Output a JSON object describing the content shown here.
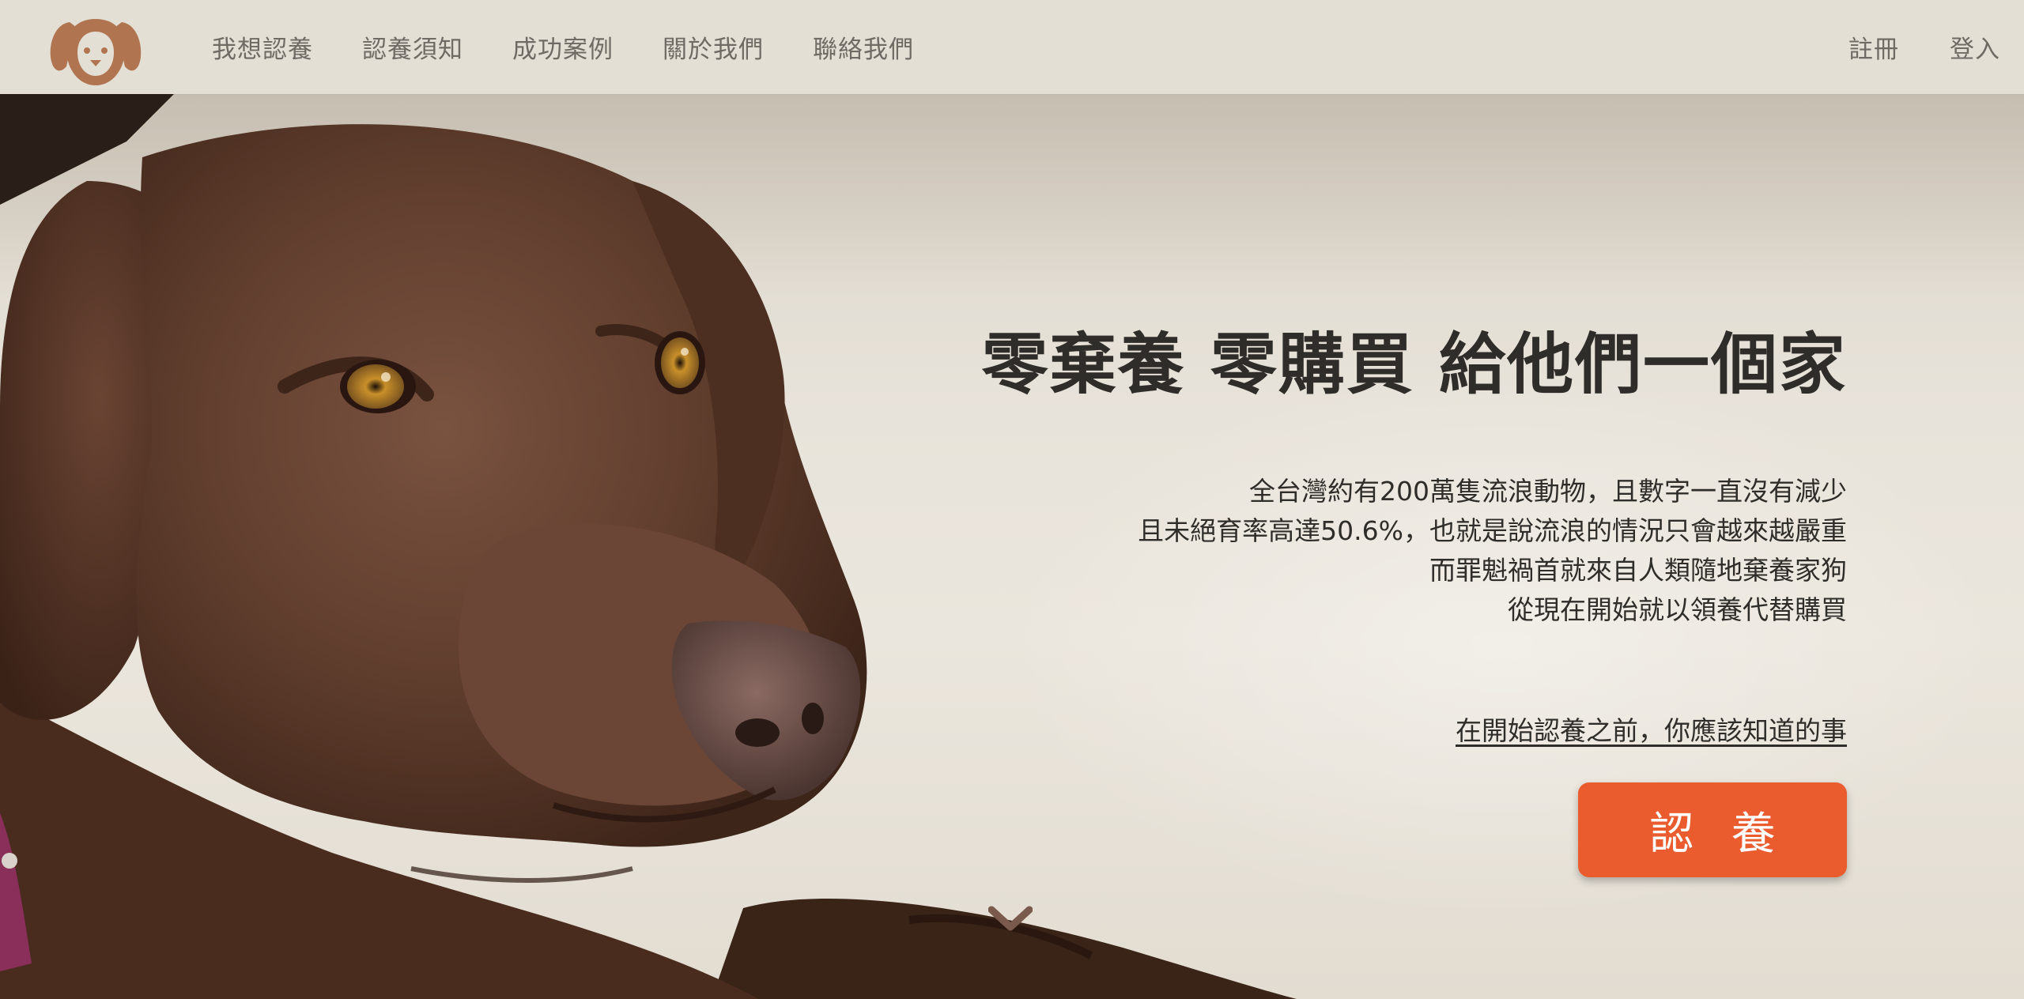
{
  "header": {
    "logo": "dog-face-logo",
    "nav": [
      {
        "label": "我想認養"
      },
      {
        "label": "認養須知"
      },
      {
        "label": "成功案例"
      },
      {
        "label": "關於我們"
      },
      {
        "label": "聯絡我們"
      }
    ],
    "auth": {
      "register": "註冊",
      "login": "登入"
    }
  },
  "hero": {
    "title": "零棄養 零購買 給他們一個家",
    "description": [
      "全台灣約有200萬隻流浪動物，且數字一直沒有減少",
      "且未絕育率高達50.6%，也就是說流浪的情況只會越來越嚴重",
      "而罪魁禍首就來自人類隨地棄養家狗",
      "從現在開始就以領養代替購買"
    ],
    "link": "在開始認養之前，你應該知道的事",
    "button": "認 養",
    "scroll_icon": "chevron-down-icon"
  },
  "colors": {
    "header_bg": "#e3dfd5",
    "nav_text": "#6f6a63",
    "accent": "#ea5b2e",
    "logo": "#b07550",
    "text_dark": "#2f2d2a"
  }
}
